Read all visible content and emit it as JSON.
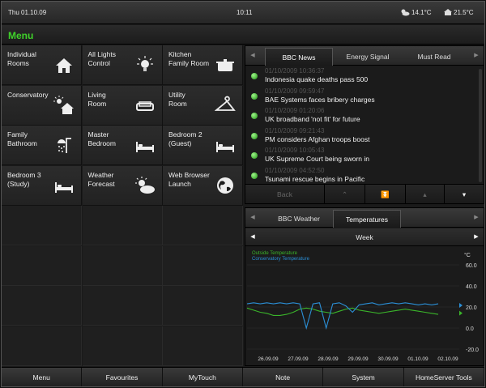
{
  "status": {
    "date": "Thu 01.10.09",
    "time": "10:11",
    "outside_temp": "14.1°C",
    "inside_temp": "21.5°C"
  },
  "menu": {
    "title": "Menu"
  },
  "tiles": [
    {
      "label": "Individual\nRooms",
      "icon": "house-icon"
    },
    {
      "label": "All Lights\nControl",
      "icon": "lightbulb-icon"
    },
    {
      "label": "Kitchen\nFamily Room",
      "icon": "cooking-pot-icon"
    },
    {
      "label": "Conservatory",
      "icon": "sun-house-icon"
    },
    {
      "label": "Living\nRoom",
      "icon": "sofa-icon"
    },
    {
      "label": "Utility\nRoom",
      "icon": "hanger-icon"
    },
    {
      "label": "Family\nBathroom",
      "icon": "shower-icon"
    },
    {
      "label": "Master\nBedroom",
      "icon": "bed-icon"
    },
    {
      "label": "Bedroom 2\n(Guest)",
      "icon": "bed-icon"
    },
    {
      "label": "Bedroom 3\n(Study)",
      "icon": "bed-icon"
    },
    {
      "label": "Weather\nForecast",
      "icon": "sun-cloud-icon"
    },
    {
      "label": "Web Browser\nLaunch",
      "icon": "globe-icon"
    }
  ],
  "news": {
    "tabs": [
      "BBC News",
      "Energy Signal",
      "Must Read"
    ],
    "items": [
      {
        "ts": "01/10/2009 10:36:37",
        "headline": "Indonesia quake deaths pass 500"
      },
      {
        "ts": "01/10/2009 09:59:47",
        "headline": "BAE Systems faces bribery charges"
      },
      {
        "ts": "01/10/2009 01:20:06",
        "headline": "UK broadband 'not fit' for future"
      },
      {
        "ts": "01/10/2009 09:21:43",
        "headline": "PM considers Afghan troops boost"
      },
      {
        "ts": "01/10/2009 10:05:43",
        "headline": "UK Supreme Court being sworn in"
      },
      {
        "ts": "01/10/2009 04:52:50",
        "headline": "Tsunami rescue begins in Pacific"
      }
    ],
    "nav": {
      "back": "Back"
    }
  },
  "weather": {
    "tabs": [
      "BBC Weather",
      "Temperatures"
    ],
    "period": "Week"
  },
  "chart_data": {
    "type": "line",
    "unit": "°C",
    "ylim": [
      -20,
      60
    ],
    "y_ticks": [
      "60.0",
      "40.0",
      "20.0",
      "0.0",
      "-20.0"
    ],
    "x_ticks": [
      "26.09.09",
      "27.09.09",
      "28.09.09",
      "29.09.09",
      "30.09.09",
      "01.10.09",
      "02.10.09"
    ],
    "series": [
      {
        "name": "Outside Temperature",
        "color": "#3ab52a",
        "values": [
          19,
          17,
          15,
          14,
          12,
          12,
          13,
          15,
          18,
          19,
          18,
          16,
          15,
          14,
          16,
          18,
          19,
          17,
          16,
          15,
          14,
          15,
          16,
          17,
          18,
          17,
          16,
          15,
          14,
          13
        ]
      },
      {
        "name": "Conservatory Temperature",
        "color": "#2b8fd6",
        "values": [
          23,
          24,
          23,
          24,
          23,
          24,
          23,
          24,
          23,
          0,
          23,
          24,
          0,
          23,
          24,
          21,
          15,
          22,
          23,
          24,
          22,
          23,
          24,
          23,
          24,
          23,
          22,
          23,
          22,
          23
        ]
      }
    ],
    "latest": {
      "outside": 14.1,
      "conservatory": 21.5
    }
  },
  "bottom": [
    "Menu",
    "Favourites",
    "MyTouch",
    "Note",
    "System",
    "HomeServer Tools"
  ]
}
